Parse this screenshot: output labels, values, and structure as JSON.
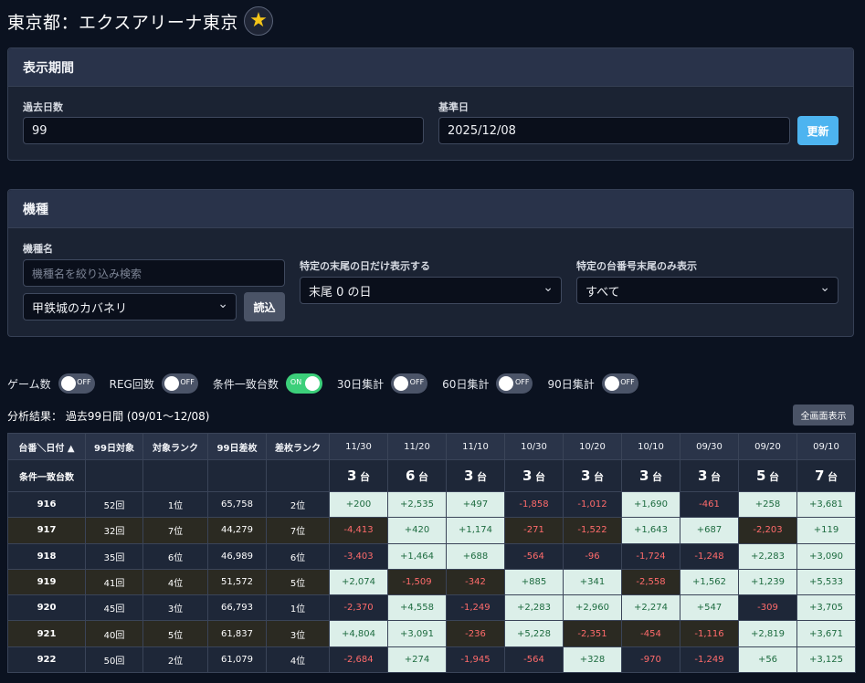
{
  "page": {
    "title": "東京都：エクスアリーナ東京"
  },
  "period": {
    "heading": "表示期間",
    "days_label": "過去日数",
    "days_value": "99",
    "base_date_label": "基準日",
    "base_date_value": "2025/12/08",
    "update_button": "更新"
  },
  "machine": {
    "heading": "機種",
    "name_label": "機種名",
    "search_placeholder": "機種名を絞り込み検索",
    "selected_machine": "甲鉄城のカバネリ",
    "load_button": "読込",
    "tail_day_label": "特定の末尾の日だけ表示する",
    "tail_day_value": "末尾 0 の日",
    "tail_unit_label": "特定の台番号末尾のみ表示",
    "tail_unit_value": "すべて"
  },
  "toggles": [
    {
      "label": "ゲーム数",
      "state": "OFF",
      "on": false
    },
    {
      "label": "REG回数",
      "state": "OFF",
      "on": false
    },
    {
      "label": "条件一致台数",
      "state": "ON",
      "on": true
    },
    {
      "label": "30日集計",
      "state": "OFF",
      "on": false
    },
    {
      "label": "60日集計",
      "state": "OFF",
      "on": false
    },
    {
      "label": "90日集計",
      "state": "OFF",
      "on": false
    }
  ],
  "result_text": "分析結果： 過去99日間 (09/01〜12/08)",
  "fullscreen_button": "全画面表示",
  "table": {
    "headers": {
      "unit": "台番＼日付 ▲",
      "count": "99日対象",
      "rank": "対象ランク",
      "diff": "99日差枚",
      "diff_rank": "差枚ランク"
    },
    "dates": [
      "11/30",
      "11/20",
      "11/10",
      "10/30",
      "10/20",
      "10/10",
      "09/30",
      "09/20",
      "09/10"
    ],
    "match_label": "条件一致台数",
    "match_unit": "台",
    "match_counts": [
      "3",
      "6",
      "3",
      "3",
      "3",
      "3",
      "3",
      "5",
      "7"
    ],
    "rows": [
      {
        "unit": "916",
        "count": "52回",
        "rank": "1位",
        "diff": "65,758",
        "diff_rank": "2位",
        "values": [
          "+200",
          "+2,535",
          "+497",
          "-1,858",
          "-1,012",
          "+1,690",
          "-461",
          "+258",
          "+3,681"
        ]
      },
      {
        "unit": "917",
        "count": "32回",
        "rank": "7位",
        "diff": "44,279",
        "diff_rank": "7位",
        "values": [
          "-4,413",
          "+420",
          "+1,174",
          "-271",
          "-1,522",
          "+1,643",
          "+687",
          "-2,203",
          "+119"
        ]
      },
      {
        "unit": "918",
        "count": "35回",
        "rank": "6位",
        "diff": "46,989",
        "diff_rank": "6位",
        "values": [
          "-3,403",
          "+1,464",
          "+688",
          "-564",
          "-96",
          "-1,724",
          "-1,248",
          "+2,283",
          "+3,090"
        ]
      },
      {
        "unit": "919",
        "count": "41回",
        "rank": "4位",
        "diff": "51,572",
        "diff_rank": "5位",
        "values": [
          "+2,074",
          "-1,509",
          "-342",
          "+885",
          "+341",
          "-2,558",
          "+1,562",
          "+1,239",
          "+5,533"
        ]
      },
      {
        "unit": "920",
        "count": "45回",
        "rank": "3位",
        "diff": "66,793",
        "diff_rank": "1位",
        "values": [
          "-2,370",
          "+4,558",
          "-1,249",
          "+2,283",
          "+2,960",
          "+2,274",
          "+547",
          "-309",
          "+3,705"
        ]
      },
      {
        "unit": "921",
        "count": "40回",
        "rank": "5位",
        "diff": "61,837",
        "diff_rank": "3位",
        "values": [
          "+4,804",
          "+3,091",
          "-236",
          "+5,228",
          "-2,351",
          "-454",
          "-1,116",
          "+2,819",
          "+3,671"
        ]
      },
      {
        "unit": "922",
        "count": "50回",
        "rank": "2位",
        "diff": "61,079",
        "diff_rank": "4位",
        "values": [
          "-2,684",
          "+274",
          "-1,945",
          "-564",
          "+328",
          "-970",
          "-1,249",
          "+56",
          "+3,125"
        ]
      }
    ]
  },
  "colors": {
    "background": "#0b1220",
    "panel": "#1b2333",
    "accent_blue": "#4db4f0",
    "toggle_on": "#3ccf7a",
    "positive_cell": "#dcefe9",
    "negative_text": "#ff6b6b",
    "star": "#f5c518"
  },
  "icons": {
    "favorite": "star-icon"
  }
}
